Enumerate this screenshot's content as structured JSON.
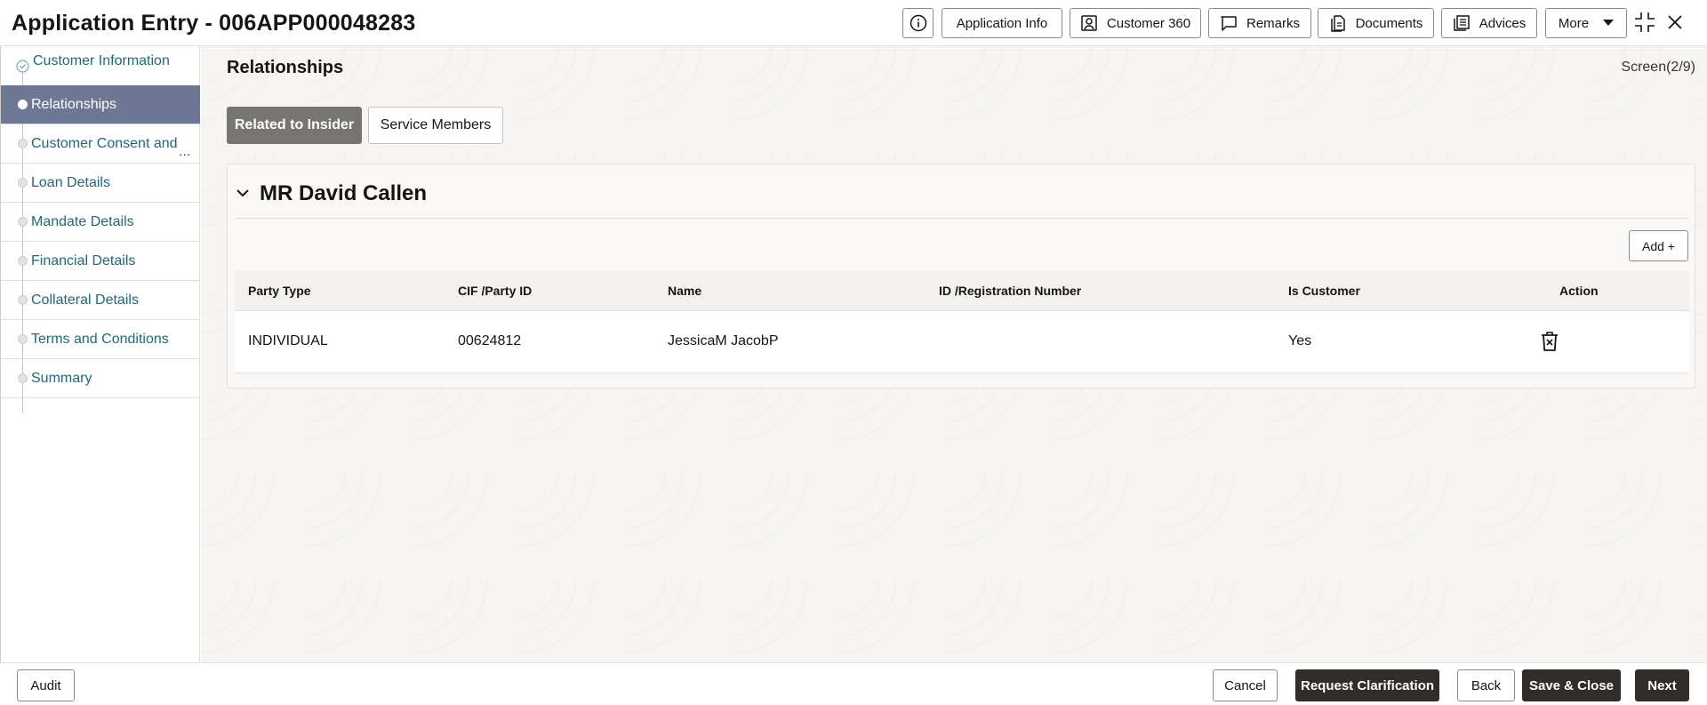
{
  "header": {
    "title": "Application Entry - 006APP000048283",
    "buttons": {
      "application_info": "Application Info",
      "customer_360": "Customer 360",
      "remarks": "Remarks",
      "documents": "Documents",
      "advices": "Advices",
      "more": "More"
    },
    "icons": [
      "info-icon",
      "customer-icon",
      "remarks-icon",
      "documents-icon",
      "advices-icon",
      "caret-down-icon",
      "minimize-icon",
      "close-icon"
    ]
  },
  "sidebar": {
    "items": [
      {
        "label": "Customer Information",
        "state": "done"
      },
      {
        "label": "Relationships",
        "state": "active"
      },
      {
        "label": "Customer Consent and",
        "state": "pending",
        "overflow": "..."
      },
      {
        "label": "Loan Details",
        "state": "pending"
      },
      {
        "label": "Mandate Details",
        "state": "pending"
      },
      {
        "label": "Financial Details",
        "state": "pending"
      },
      {
        "label": "Collateral Details",
        "state": "pending"
      },
      {
        "label": "Terms and Conditions",
        "state": "pending"
      },
      {
        "label": "Summary",
        "state": "pending"
      }
    ]
  },
  "main": {
    "title": "Relationships",
    "screen_indicator": "Screen(2/9)",
    "tabs": [
      {
        "label": "Related to Insider",
        "active": true
      },
      {
        "label": "Service Members",
        "active": false
      }
    ],
    "panel": {
      "title": "MR David Callen",
      "add_label": "Add +",
      "table": {
        "headers": [
          "Party Type",
          "CIF /Party ID",
          "Name",
          "ID /Registration Number",
          "Is Customer",
          "Action"
        ],
        "rows": [
          {
            "party_type": "INDIVIDUAL",
            "cif": "00624812",
            "name": "JessicaM JacobP",
            "id_reg": "",
            "is_customer": "Yes"
          }
        ]
      }
    }
  },
  "footer": {
    "audit": "Audit",
    "cancel": "Cancel",
    "request_clarification": "Request Clarification",
    "back": "Back",
    "save_close": "Save & Close",
    "next": "Next"
  },
  "colors": {
    "sidebar_active": "#6e7895",
    "nav_link": "#1a6a80",
    "dark_button": "#312d2a",
    "tab_active": "#777572"
  }
}
